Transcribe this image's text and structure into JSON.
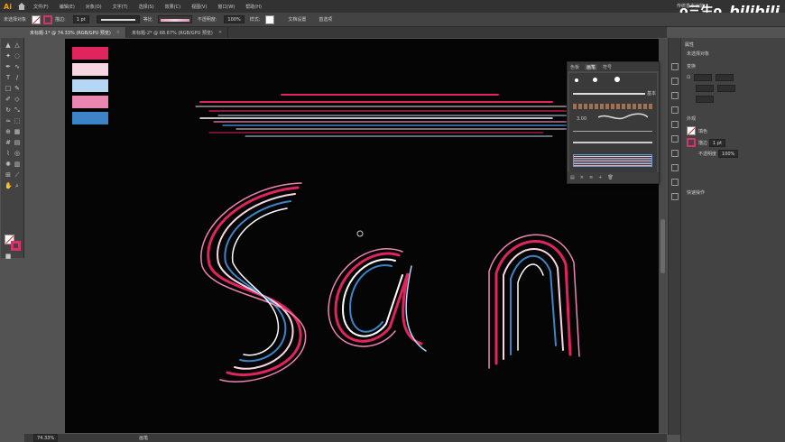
{
  "app": {
    "logo": "Ai",
    "menu": [
      "文件(F)",
      "编辑(E)",
      "对象(O)",
      "文字(T)",
      "选择(S)",
      "效果(C)",
      "视图(V)",
      "窗口(W)",
      "帮助(H)"
    ],
    "workspace": "传统基本功能"
  },
  "watermark": {
    "left": "o三生o",
    "right": "bilibili"
  },
  "control": {
    "label": "未选择对象",
    "stroke_label": "描边:",
    "stroke_value": "1 pt",
    "style_label": "等比",
    "opacity_label": "不透明度:",
    "opacity_value": "100%",
    "style2": "样式:",
    "doc_settings": "文档设置",
    "prefs": "首选项"
  },
  "tabs": [
    {
      "title": "未标题-1* @ 74.33% (RGB/GPU 预览)",
      "close": "×",
      "active": true
    },
    {
      "title": "未标题-2* @ 68.67% (RGB/GPU 预览)",
      "close": "×",
      "active": false
    }
  ],
  "status": {
    "zoom": "74.33%",
    "tool": "画笔"
  },
  "palette": {
    "colors": [
      "#e0245e",
      "#f7d6e2",
      "#b5d6f5",
      "#ea86b0",
      "#3d83c8"
    ]
  },
  "brushes_panel": {
    "tabs": [
      "色板",
      "画笔",
      "符号"
    ],
    "active_tab": "画笔",
    "size_label": "3.00",
    "basic_label": "基本"
  },
  "right_panel": {
    "title": "属性",
    "section1": "未选择对象",
    "transform": "变换",
    "appearance": "外观",
    "fill_label": "填色",
    "stroke_label": "描边",
    "stroke_value": "1 pt",
    "opacity_label": "不透明度",
    "opacity_value": "100%",
    "quick_actions": "快速操作"
  }
}
